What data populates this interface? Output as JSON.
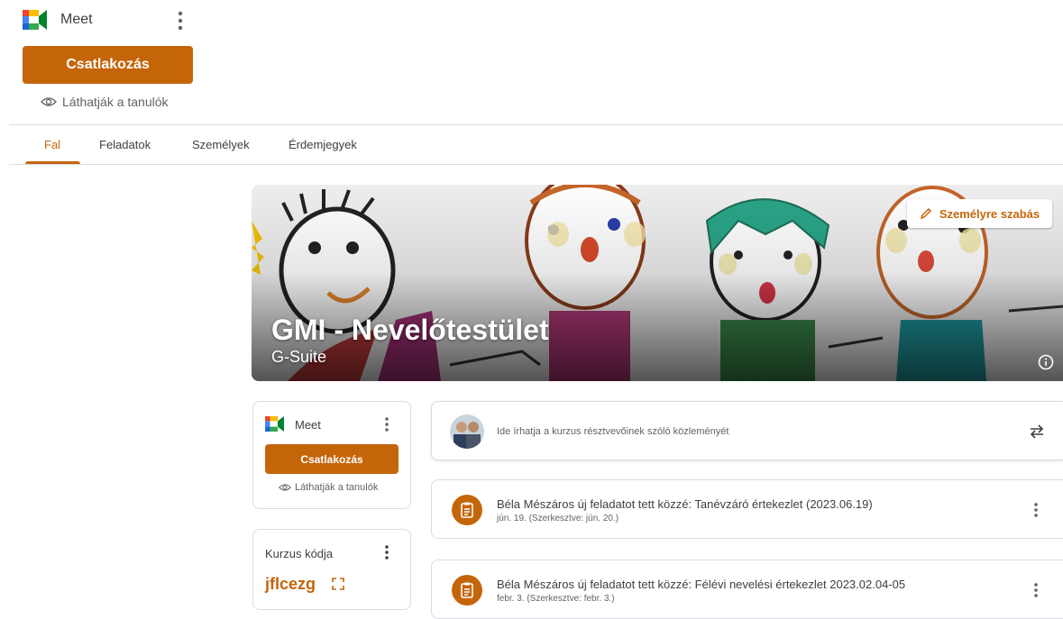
{
  "top_meet": {
    "title": "Meet",
    "join_label": "Csatlakozás",
    "visibility_label": "Láthatják a tanulók"
  },
  "tabs": [
    {
      "label": "Fal",
      "active": true
    },
    {
      "label": "Feladatok",
      "active": false
    },
    {
      "label": "Személyek",
      "active": false
    },
    {
      "label": "Érdemjegyek",
      "active": false
    }
  ],
  "banner": {
    "title": "GMI - Nevelőtestület",
    "subtitle": "G-Suite",
    "customize_label": "Személyre szabás"
  },
  "meet_card": {
    "title": "Meet",
    "join_label": "Csatlakozás",
    "visibility_label": "Láthatják a tanulók"
  },
  "code_card": {
    "title": "Kurzus kódja",
    "code": "jflcezg"
  },
  "announce": {
    "placeholder": "Ide írhatja a kurzus résztvevőinek szóló közleményét"
  },
  "posts": [
    {
      "title": "Béla Mészáros új feladatot tett közzé: Tanévzáró értekezlet (2023.06.19)",
      "date": "jún. 19. (Szerkesztve: jún. 20.)"
    },
    {
      "title": "Béla Mészáros új feladatot tett közzé: Félévi nevelési értekezlet 2023.02.04-05",
      "date": "febr. 3. (Szerkesztve: febr. 3.)"
    }
  ],
  "colors": {
    "accent": "#c5650a",
    "text": "#3c4043",
    "muted": "#5f6368",
    "divider": "#dadce0"
  }
}
